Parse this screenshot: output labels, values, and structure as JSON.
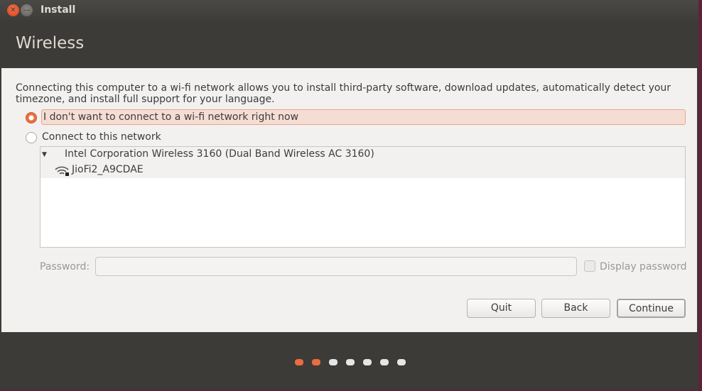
{
  "window": {
    "title": "Install",
    "close_icon": "close-icon",
    "minimize_icon": "minimize-icon"
  },
  "header": {
    "title": "Wireless"
  },
  "main": {
    "description": "Connecting this computer to a wi-fi network allows you to install third-party software, download updates, automatically detect your timezone, and install full support for your language.",
    "options": [
      {
        "label": "I don't want to connect to a wi-fi network right now",
        "selected": true
      },
      {
        "label": "Connect to this network",
        "selected": false
      }
    ],
    "networks": {
      "device": "Intel Corporation Wireless 3160 (Dual Band Wireless AC 3160)",
      "items": [
        {
          "ssid": "JioFi2_A9CDAE",
          "icon": "wifi-secure-icon"
        }
      ]
    },
    "password": {
      "label": "Password:",
      "value": ""
    },
    "display_password": {
      "label": "Display password",
      "checked": false
    },
    "buttons": {
      "quit": "Quit",
      "back": "Back",
      "continue": "Continue"
    }
  },
  "progress": {
    "steps": 7,
    "current": 2
  },
  "colors": {
    "accent": "#ea6d3e",
    "panel": "#3c3b37",
    "content": "#f2f1f0"
  }
}
